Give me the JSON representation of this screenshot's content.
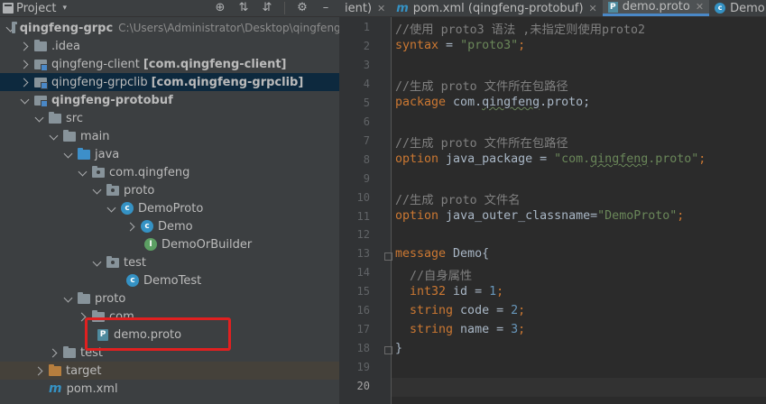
{
  "project_panel": {
    "title": "Project",
    "tree": [
      {
        "label": "qingfeng-grpc",
        "path": "C:\\Users\\Administrator\\Desktop\\qingfeng-"
      },
      {
        "label": ".idea"
      },
      {
        "label": "qingfeng-client",
        "module": "[com.qingfeng-client]"
      },
      {
        "label": "qingfeng-grpclib",
        "module": "[com.qingfeng-grpclib]"
      },
      {
        "label": "qingfeng-protobuf"
      },
      {
        "label": "src"
      },
      {
        "label": "main"
      },
      {
        "label": "java"
      },
      {
        "label": "com.qingfeng"
      },
      {
        "label": "proto"
      },
      {
        "label": "DemoProto"
      },
      {
        "label": "Demo"
      },
      {
        "label": "DemoOrBuilder"
      },
      {
        "label": "test"
      },
      {
        "label": "DemoTest"
      },
      {
        "label": "proto"
      },
      {
        "label": "com"
      },
      {
        "label": "demo.proto"
      },
      {
        "label": "test"
      },
      {
        "label": "target"
      },
      {
        "label": "pom.xml"
      }
    ]
  },
  "editor": {
    "tabs": [
      {
        "label": "ient)"
      },
      {
        "label": "pom.xml (qingfeng-protobuf)"
      },
      {
        "label": "demo.proto"
      },
      {
        "label": "DemoPro"
      }
    ],
    "line_numbers": [
      "1",
      "2",
      "3",
      "4",
      "5",
      "6",
      "7",
      "8",
      "9",
      "10",
      "11",
      "12",
      "13",
      "14",
      "15",
      "16",
      "17",
      "18",
      "19",
      "20"
    ],
    "code": {
      "l1": "//使用 proto3 语法 ,未指定则使用proto2",
      "l2_kw": "syntax",
      "l2_eq": " = ",
      "l2_str": "\"proto3\"",
      "l2_end": ";",
      "l4": "//生成 proto 文件所在包路径",
      "l5_kw": "package",
      "l5_a": " com.",
      "l5_b": "qingfeng",
      "l5_c": ".proto;",
      "l7": "//生成 proto 文件所在包路径",
      "l8_kw": "option",
      "l8_a": " java_package = ",
      "l8_s1": "\"com.",
      "l8_s2": "qingfeng",
      "l8_s3": ".proto\"",
      "l8_end": ";",
      "l10": "//生成 proto 文件名",
      "l11_kw": "option",
      "l11_a": " java_outer_classname=",
      "l11_str": "\"DemoProto\"",
      "l11_end": ";",
      "l13_kw": "message",
      "l13_a": " Demo{",
      "l14": "  //自身属性",
      "l15_kw": "  int32",
      "l15_a": " id = ",
      "l15_n": "1",
      "l15_end": ";",
      "l16_kw": "  string",
      "l16_a": " code = ",
      "l16_n": "2",
      "l16_end": ";",
      "l17_kw": "  string",
      "l17_a": " name = ",
      "l17_n": "3",
      "l17_end": ";",
      "l18": "}"
    }
  }
}
